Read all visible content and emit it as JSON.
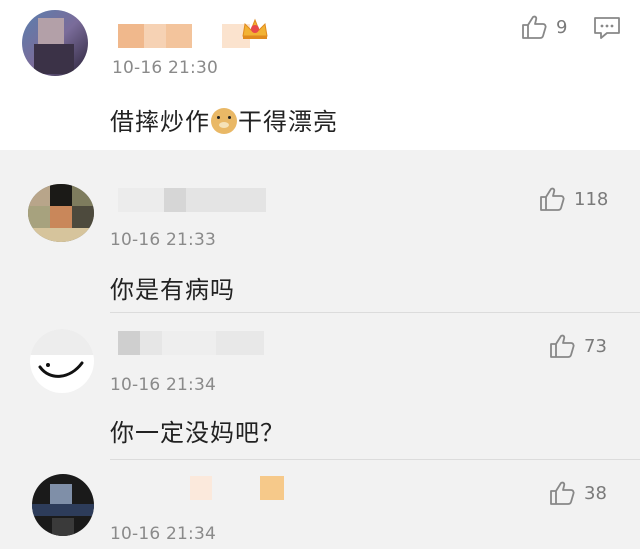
{
  "comments": [
    {
      "time": "10-16 21:30",
      "text_before": "借摔炒作",
      "text_after": "干得漂亮",
      "likes": "9",
      "emoji": "doge-emoji"
    },
    {
      "time": "10-16 21:33",
      "text": "你是有病吗",
      "likes": "118"
    },
    {
      "time": "10-16 21:34",
      "text": "你一定没妈吧？",
      "likes": "73"
    },
    {
      "time": "10-16 21:34",
      "text": "",
      "likes": "38"
    }
  ],
  "icons": {
    "like": "thumbs-up-icon",
    "reply": "message-icon",
    "badge": "crown-icon"
  },
  "colors": {
    "top_background": "#ffffff",
    "reply_background": "#f2f2f2",
    "time_text": "#8a8a8a",
    "like_text": "#7a7a7a"
  }
}
